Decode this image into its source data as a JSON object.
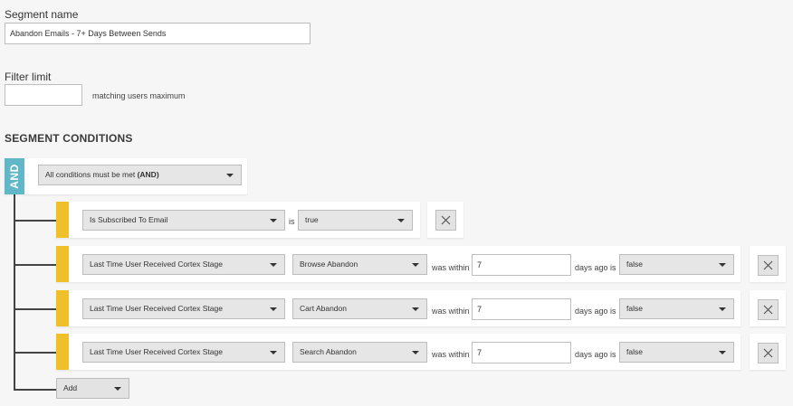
{
  "segment_name": {
    "label": "Segment name",
    "value": "Abandon Emails - 7+ Days Between Sends"
  },
  "filter_limit": {
    "label": "Filter limit",
    "value": "",
    "suffix": "matching users maximum"
  },
  "conditions": {
    "heading": "SEGMENT CONDITIONS",
    "operator_badge": "AND",
    "operator_select": {
      "text": "All conditions must be met ",
      "bold": "(AND)"
    },
    "rows": [
      {
        "field": "Is Subscribed To Email",
        "is_label": "is",
        "value": "true"
      },
      {
        "field": "Last Time User Received Cortex Stage",
        "stage": "Browse Abandon",
        "within_label": "was within",
        "days": "7",
        "days_ago_label": "days ago",
        "is_label": "is",
        "value": "false"
      },
      {
        "field": "Last Time User Received Cortex Stage",
        "stage": "Cart Abandon",
        "within_label": "was within",
        "days": "7",
        "days_ago_label": "days ago",
        "is_label": "is",
        "value": "false"
      },
      {
        "field": "Last Time User Received Cortex Stage",
        "stage": "Search Abandon",
        "within_label": "was within",
        "days": "7",
        "days_ago_label": "days ago",
        "is_label": "is",
        "value": "false"
      }
    ],
    "add_label": "Add"
  },
  "colors": {
    "background": "#f6f6f6",
    "and_badge": "#5fb7c8",
    "condition_marker": "#f0c02b",
    "connector": "#444444"
  },
  "icons": {
    "close": "close-icon",
    "dropdown": "chevron-down-icon"
  }
}
